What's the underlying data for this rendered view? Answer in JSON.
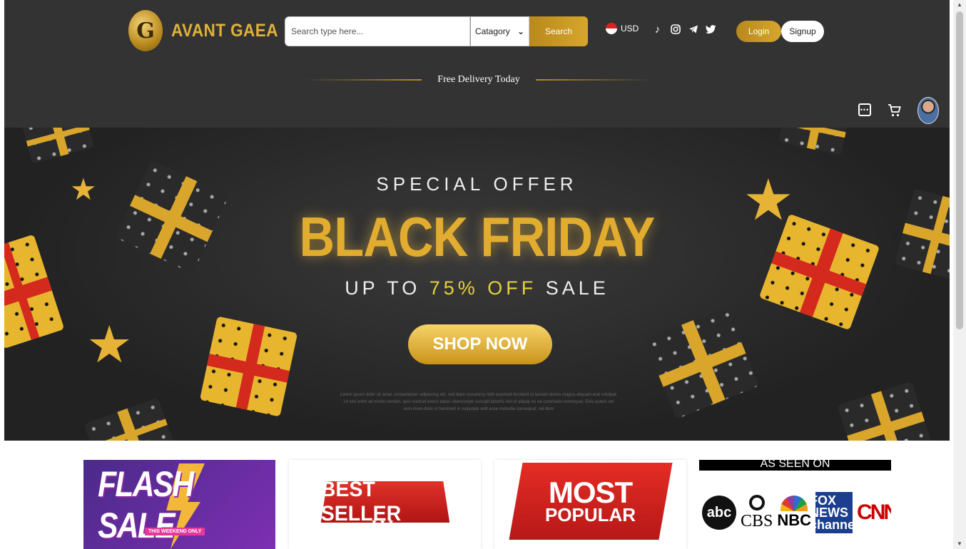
{
  "header": {
    "logo_letter": "G",
    "brand": "AVANT GAEA",
    "search": {
      "placeholder": "Search type here...",
      "category_selected": "Catagory",
      "button_label": "Search"
    },
    "currency": "USD",
    "socials": [
      "tiktok-icon",
      "instagram-icon",
      "telegram-icon",
      "twitter-icon"
    ],
    "login_label": "Login",
    "signup_label": "Signup",
    "delivery_text": "Free Delivery Today",
    "icons": [
      "chat-icon",
      "cart-icon",
      "avatar"
    ]
  },
  "hero": {
    "special": "SPECIAL OFFER",
    "title": "BLACK FRIDAY",
    "sub_prefix": "UP TO ",
    "sub_pct": "75% OFF",
    "sub_suffix": " SALE",
    "button": "SHOP NOW",
    "lorem": "Lorem ipsum dolor sit amet, consectetuer adipiscing elit, sed diam nonummy nibh euismod tincidunt ut laoreet dolore magna aliquam erat volutpat. Ut wisi enim ad minim veniam, quis nostrud exerci tation ullamcorper suscipit lobortis nisl ut aliquip ex ea commodo consequat. Duis autem vel eum iriure dolor in hendrerit in vulputate velit esse molestie consequat, vel illum"
  },
  "cards": {
    "flash": {
      "title": "FLASH SALE",
      "sub": "THIS WEEKEND ONLY"
    },
    "best": {
      "title": "BEST SELLER"
    },
    "popular": {
      "line1": "MOST",
      "line2": "POPULAR"
    },
    "seen": {
      "title": "AS SEEN ON",
      "logos": [
        "abc",
        "CBS",
        "NBC",
        "FOX NEWS channel",
        "CNN"
      ]
    }
  },
  "colors": {
    "header_bg": "#333333",
    "gold": "#d6a62c",
    "hero_bg": "#2b2b2b",
    "red": "#d42a1e"
  }
}
